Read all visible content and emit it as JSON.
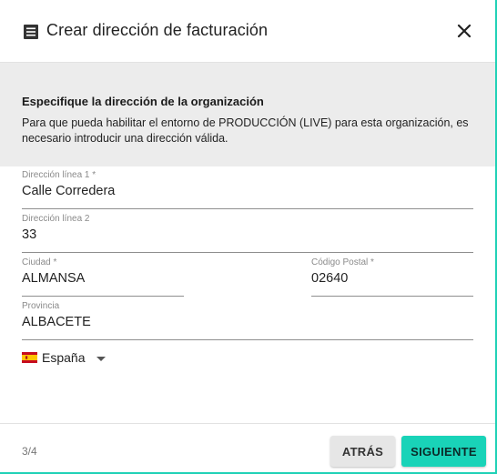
{
  "dialog": {
    "title": "Crear dirección de facturación",
    "icon": "document-list-icon",
    "close_icon": "close-icon"
  },
  "info": {
    "heading": "Especifique la dirección de la organización",
    "text": "Para que pueda habilitar el entorno de PRODUCCIÓN (LIVE) para esta organización, es necesario introducir una dirección válida."
  },
  "form": {
    "address1": {
      "label": "Dirección línea 1 *",
      "value": "Calle Corredera"
    },
    "address2": {
      "label": "Dirección línea 2",
      "value": "33"
    },
    "city": {
      "label": "Ciudad *",
      "value": "ALMANSA"
    },
    "postal_code": {
      "label": "Código Postal *",
      "value": "02640"
    },
    "province": {
      "label": "Provincia",
      "value": "ALBACETE"
    },
    "country": {
      "value": "España",
      "flag_icon": "spain-flag-icon"
    }
  },
  "footer": {
    "step": "3/4",
    "back_label": "ATRÁS",
    "next_label": "SIGUIENTE"
  },
  "colors": {
    "accent": "#19d3b8",
    "info_bg": "#ececec"
  }
}
